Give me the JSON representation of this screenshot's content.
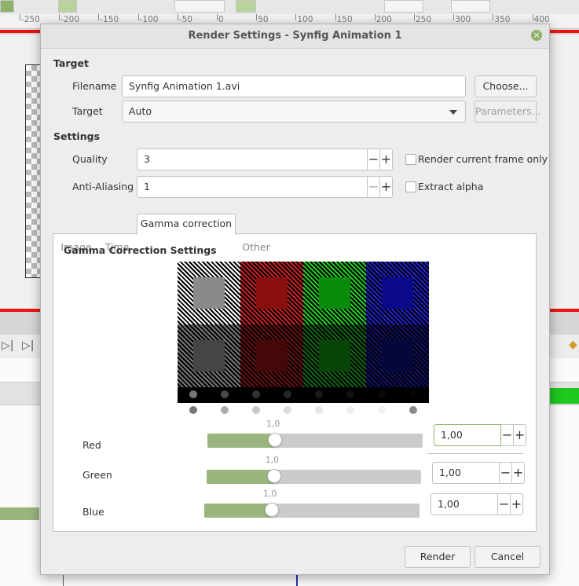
{
  "ruler": {
    "labels": [
      "-250",
      "-200",
      "-150",
      "-100",
      "-50",
      "0",
      "50",
      "100",
      "150",
      "200",
      "250",
      "300",
      "350",
      "400"
    ]
  },
  "dialog": {
    "title": "Render Settings - Synfig Animation 1",
    "close_glyph": "×",
    "target_section": "Target",
    "filename_label": "Filename",
    "filename_value": "Synfig Animation 1.avi",
    "choose_button": "Choose...",
    "target_label": "Target",
    "target_value": "Auto",
    "parameters_button": "Parameters...",
    "settings_section": "Settings",
    "quality_label": "Quality",
    "quality_value": "3",
    "antialiasing_label": "Anti-Aliasing",
    "antialiasing_value": "1",
    "render_current_frame_label": "Render current frame only",
    "extract_alpha_label": "Extract alpha",
    "minus": "−",
    "plus": "+",
    "tabs": [
      "Image",
      "Time",
      "Gamma correction",
      "Other"
    ],
    "active_tab": "Gamma correction",
    "gamma_section": "Gamma Correction Settings",
    "channels": [
      {
        "label": "Red",
        "slider_value": "1,0",
        "entry_value": "1,00"
      },
      {
        "label": "Green",
        "slider_value": "1,0",
        "entry_value": "1,00"
      },
      {
        "label": "Blue",
        "slider_value": "1,0",
        "entry_value": "1,00"
      }
    ],
    "slider_fraction": 0.31,
    "render_button": "Render",
    "cancel_button": "Cancel"
  },
  "colors": {
    "accent": "#9ab57d",
    "redline": "#ee1111",
    "swatch_red": "#8a1010",
    "swatch_green": "#0a8a0a",
    "swatch_blue": "#0a0a8a"
  }
}
